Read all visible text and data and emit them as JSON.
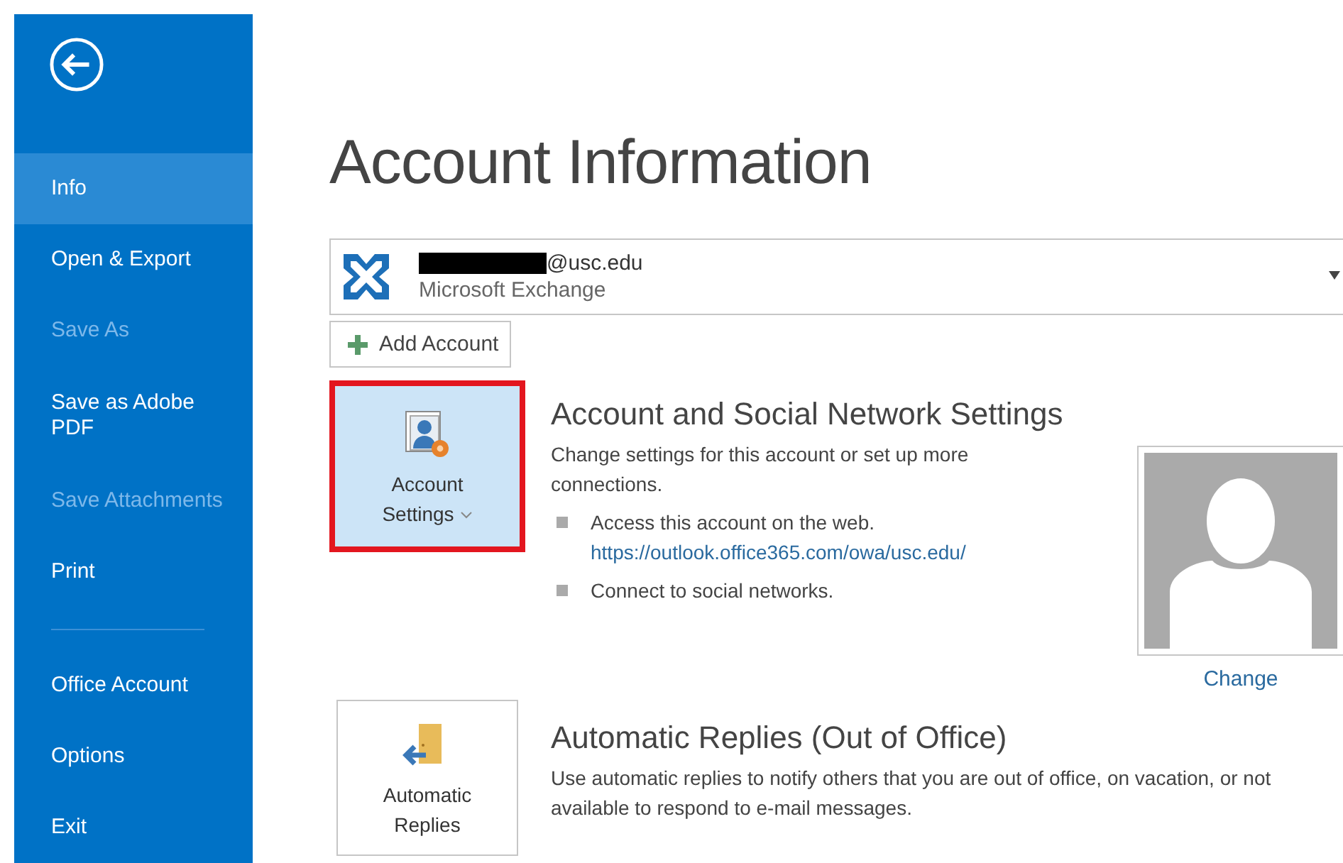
{
  "sidebar": {
    "items": [
      {
        "label": "Info",
        "selected": true,
        "disabled": false
      },
      {
        "label": "Open & Export",
        "selected": false,
        "disabled": false
      },
      {
        "label": "Save As",
        "selected": false,
        "disabled": true
      },
      {
        "label": "Save as Adobe PDF",
        "selected": false,
        "disabled": false
      },
      {
        "label": "Save Attachments",
        "selected": false,
        "disabled": true
      },
      {
        "label": "Print",
        "selected": false,
        "disabled": false
      }
    ],
    "footer_items": [
      {
        "label": "Office Account",
        "selected": false,
        "disabled": false
      },
      {
        "label": "Options",
        "selected": false,
        "disabled": false
      },
      {
        "label": "Exit",
        "selected": false,
        "disabled": false
      }
    ]
  },
  "page_title": "Account Information",
  "account": {
    "email": "@usc.edu",
    "redacted": true,
    "type": "Microsoft Exchange"
  },
  "add_account": "Add Account",
  "sections": [
    {
      "kind": "settings",
      "button_lines": [
        "Account",
        "Settings"
      ],
      "has_menu": true,
      "highlighted": true,
      "title": "Account and Social Network Settings",
      "description": "Change settings for this account or set up more connections.",
      "bullets": [
        {
          "text": "Access this account on the web.",
          "link": "https://outlook.office365.com/owa/usc.edu/"
        },
        {
          "text": "Connect to social networks."
        }
      ],
      "photo_link": "Change"
    },
    {
      "kind": "replies",
      "button_lines": [
        "Automatic",
        "Replies"
      ],
      "has_menu": false,
      "highlighted": false,
      "title": "Automatic Replies (Out of Office)",
      "description": "Use automatic replies to notify others that you are out of office, on vacation, or not available to respond to e-mail messages."
    }
  ]
}
